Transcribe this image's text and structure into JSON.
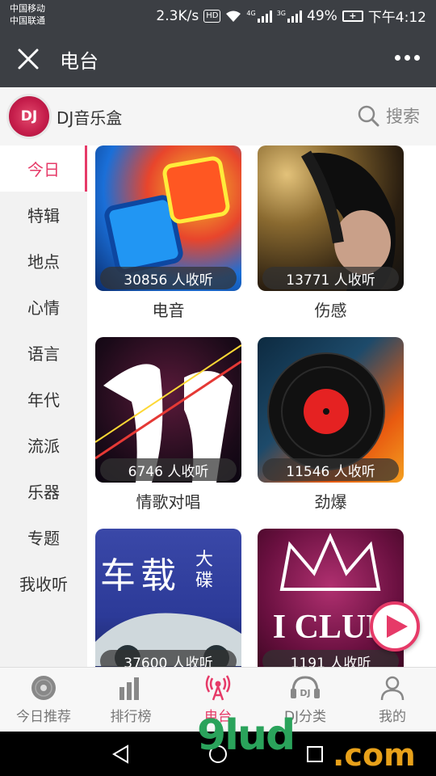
{
  "status": {
    "carrier1": "中国移动",
    "carrier2": "中国联通",
    "speed": "2.3K/s",
    "hd": "HD",
    "net1": "4G",
    "net2": "3G",
    "battery": "49%",
    "time": "下午4:12"
  },
  "titlebar": {
    "title": "电台"
  },
  "appbar": {
    "logo_text": "DJ",
    "name": "DJ音乐盒",
    "search_label": "搜索"
  },
  "sidebar": {
    "items": [
      {
        "label": "今日"
      },
      {
        "label": "特辑"
      },
      {
        "label": "地点"
      },
      {
        "label": "心情"
      },
      {
        "label": "语言"
      },
      {
        "label": "年代"
      },
      {
        "label": "流派"
      },
      {
        "label": "乐器"
      },
      {
        "label": "专题"
      },
      {
        "label": "我收听"
      }
    ]
  },
  "cards": [
    {
      "title": "电音",
      "listeners": "30856 人收听"
    },
    {
      "title": "伤感",
      "listeners": "13771 人收听"
    },
    {
      "title": "情歌对唱",
      "listeners": "6746 人收听"
    },
    {
      "title": "劲爆",
      "listeners": "11546 人收听"
    },
    {
      "title": "",
      "listeners": "37600 人收听",
      "cover_text": "车载",
      "cover_text2": "大碟"
    },
    {
      "title": "",
      "listeners": "1191 人收听",
      "cover_text": "I CLUB"
    }
  ],
  "tabs": [
    {
      "label": "今日推荐"
    },
    {
      "label": "排行榜"
    },
    {
      "label": "电台"
    },
    {
      "label": "DJ分类"
    },
    {
      "label": "我的"
    }
  ],
  "watermark": {
    "text": "9lud",
    "suffix": ".com"
  },
  "colors": {
    "accent": "#e63a68",
    "header": "#3c3f44"
  }
}
